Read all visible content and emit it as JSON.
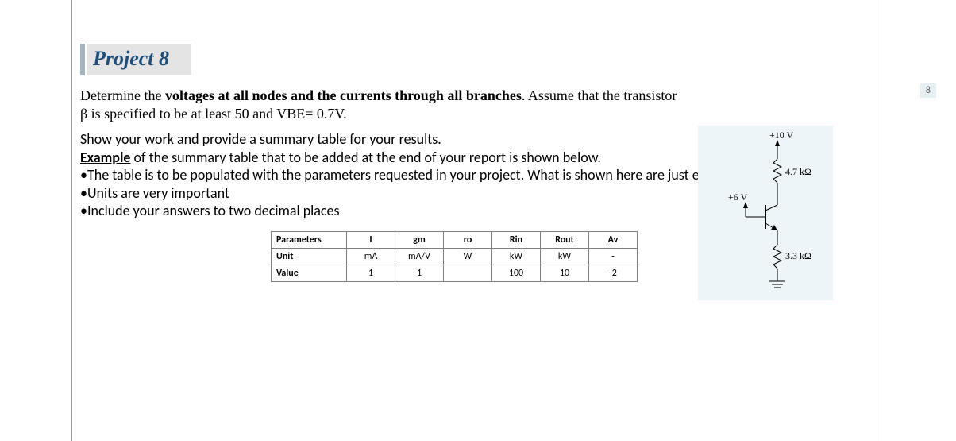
{
  "page_no": "8",
  "title": "Project 8",
  "prompt": {
    "pre": "Determine the ",
    "bold": "voltages at all nodes and the currents through all branches",
    "post1": ". Assume that the transistor ",
    "post2": "β is specified to be at least 50 and VBE= 0.7V."
  },
  "notes": {
    "line1a": "Show your work and provide a summary table for your results.",
    "line2a": "Example",
    "line2b": " of the summary table that to be added at the end of your report is shown below.",
    "b1": "•The table is to be populated with the parameters requested in your project. What is shown here are just examples",
    "b2": "•Units are very important",
    "b3": "•Include your answers to two decimal places"
  },
  "table": {
    "r0": [
      "Parameters",
      "I",
      "gm",
      "ro",
      "Rin",
      "Rout",
      "Av"
    ],
    "r1": [
      "Unit",
      "mA",
      "mA/V",
      "W",
      "kW",
      "kW",
      "-"
    ],
    "r2": [
      "Value",
      "1",
      "1",
      "",
      "100",
      "10",
      "-2"
    ]
  },
  "circuit": {
    "vcc": "+10 V",
    "r1": "4.7 kΩ",
    "vb": "+6 V",
    "r2": "3.3 kΩ"
  }
}
